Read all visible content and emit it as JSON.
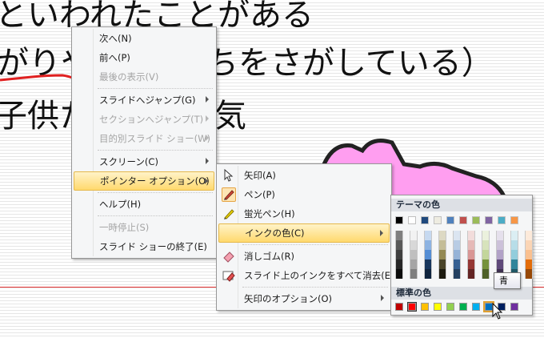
{
  "slide": {
    "line1": "といわれたことがある",
    "line2": "がりや",
    "line2b": "ちをさがしている）",
    "line3": "子供た",
    "line3b": "気"
  },
  "context_menu": {
    "items": [
      {
        "label": "次へ(N)",
        "disabled": false,
        "submenu": false
      },
      {
        "label": "前へ(P)",
        "disabled": false,
        "submenu": false
      },
      {
        "label": "最後の表示(V)",
        "disabled": true,
        "submenu": false
      },
      {
        "label": "スライドへジャンプ(G)",
        "disabled": false,
        "submenu": true
      },
      {
        "label": "セクションへジャンプ(T)",
        "disabled": true,
        "submenu": true
      },
      {
        "label": "目的別スライド ショー(W)",
        "disabled": true,
        "submenu": true
      },
      {
        "label": "スクリーン(C)",
        "disabled": false,
        "submenu": true
      },
      {
        "label": "ポインター オプション(O)",
        "disabled": false,
        "submenu": true,
        "active": true
      },
      {
        "label": "ヘルプ(H)",
        "disabled": false,
        "submenu": false
      },
      {
        "label": "一時停止(S)",
        "disabled": true,
        "submenu": false
      },
      {
        "label": "スライド ショーの終了(E)",
        "disabled": false,
        "submenu": false
      }
    ]
  },
  "pointer_menu": {
    "items": [
      {
        "label": "矢印(A)",
        "icon": "arrow-pointer-icon"
      },
      {
        "label": "ペン(P)",
        "icon": "pen-icon",
        "checked": true
      },
      {
        "label": "蛍光ペン(H)",
        "icon": "highlighter-icon"
      },
      {
        "label": "インクの色(C)",
        "icon": "",
        "submenu": true,
        "active": true
      },
      {
        "label": "消しゴム(R)",
        "icon": "eraser-icon"
      },
      {
        "label": "スライド上のインクをすべて消去(E)",
        "icon": "erase-all-ink-icon"
      },
      {
        "label": "矢印のオプション(O)",
        "icon": "",
        "submenu": true
      }
    ]
  },
  "ink_palette": {
    "theme_title": "テーマの色",
    "standard_title": "標準の色",
    "theme_colors": [
      "#000000",
      "#ffffff",
      "#1f497d",
      "#eeece1",
      "#4f81bd",
      "#c0504d",
      "#9bbb59",
      "#8064a2",
      "#4bacc6",
      "#f79646"
    ],
    "theme_shades": [
      [
        "#7f7f7f",
        "#595959",
        "#3f3f3f",
        "#262626",
        "#0c0c0c"
      ],
      [
        "#f2f2f2",
        "#d8d8d8",
        "#bfbfbf",
        "#a5a5a5",
        "#7f7f7f"
      ],
      [
        "#c6d9f0",
        "#8db3e2",
        "#548dd4",
        "#17365d",
        "#0f243e"
      ],
      [
        "#ddd9c3",
        "#c4bd97",
        "#938953",
        "#494429",
        "#1d1b10"
      ],
      [
        "#dbe5f1",
        "#b8cce4",
        "#95b3d7",
        "#366092",
        "#244061"
      ],
      [
        "#f2dcdb",
        "#e5b9b7",
        "#d99694",
        "#953734",
        "#632423"
      ],
      [
        "#ebf1dd",
        "#d7e3bc",
        "#c3d69b",
        "#76923c",
        "#4f6128"
      ],
      [
        "#e5e0ec",
        "#ccc1d9",
        "#b2a2c7",
        "#5f497a",
        "#3f3151"
      ],
      [
        "#dbeef3",
        "#b7dde8",
        "#92cddc",
        "#31859b",
        "#205867"
      ],
      [
        "#fdeada",
        "#fbd5b5",
        "#fac08f",
        "#e36c09",
        "#974806"
      ]
    ],
    "standard_colors": [
      "#c00000",
      "#ff0000",
      "#ffc000",
      "#ffff00",
      "#92d050",
      "#00b050",
      "#00b0f0",
      "#0070c0",
      "#002060",
      "#7030a0"
    ],
    "selected_standard_index": 1,
    "hover_standard_index": 7,
    "tooltip": "青"
  }
}
